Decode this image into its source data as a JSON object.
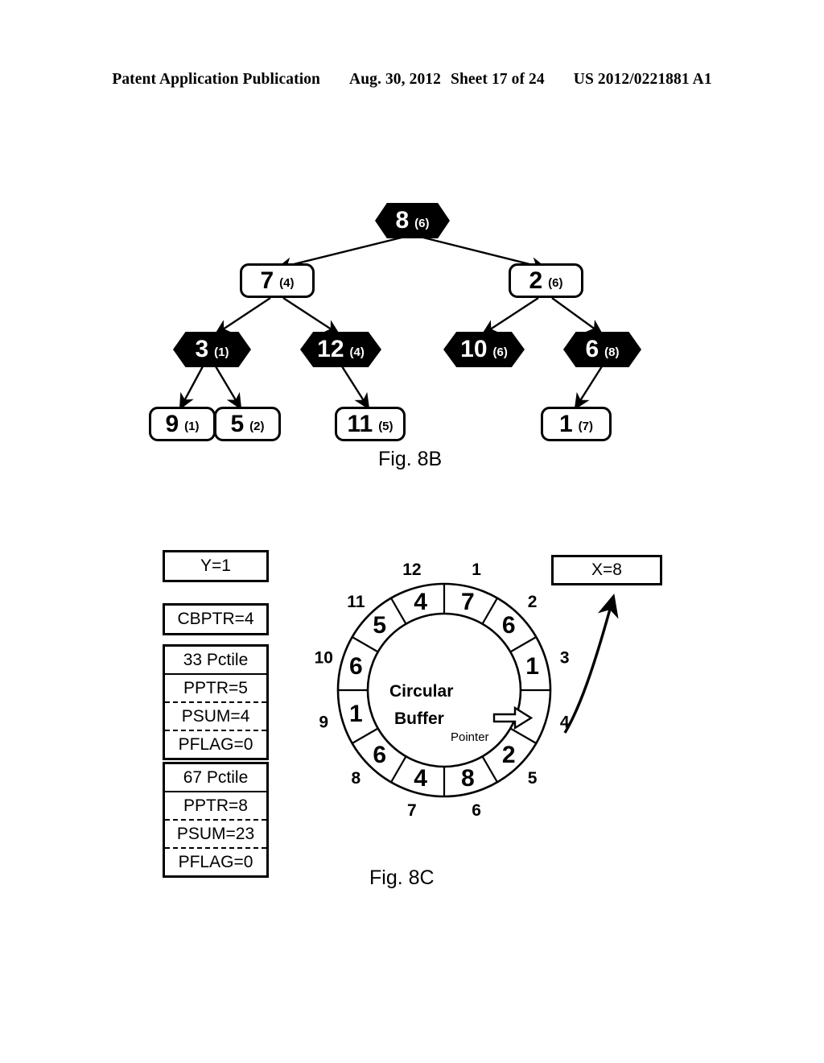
{
  "header": {
    "publication": "Patent Application Publication",
    "date": "Aug. 30, 2012",
    "sheet": "Sheet 17 of 24",
    "patent_number": "US 2012/0221881 A1"
  },
  "fig8b": {
    "caption": "Fig. 8B",
    "nodes": [
      {
        "id": "n8",
        "value": "8",
        "count": "(6)",
        "shape": "hexagon",
        "fill": "black"
      },
      {
        "id": "n7",
        "value": "7",
        "count": "(4)",
        "shape": "rectangle",
        "fill": "white"
      },
      {
        "id": "n2",
        "value": "2",
        "count": "(6)",
        "shape": "rectangle",
        "fill": "white"
      },
      {
        "id": "n3",
        "value": "3",
        "count": "(1)",
        "shape": "hexagon",
        "fill": "black"
      },
      {
        "id": "n12",
        "value": "12",
        "count": "(4)",
        "shape": "hexagon",
        "fill": "black"
      },
      {
        "id": "n10",
        "value": "10",
        "count": "(6)",
        "shape": "hexagon",
        "fill": "black"
      },
      {
        "id": "n6",
        "value": "6",
        "count": "(8)",
        "shape": "hexagon",
        "fill": "black"
      },
      {
        "id": "n9",
        "value": "9",
        "count": "(1)",
        "shape": "rectangle",
        "fill": "white"
      },
      {
        "id": "n5",
        "value": "5",
        "count": "(2)",
        "shape": "rectangle",
        "fill": "white"
      },
      {
        "id": "n11",
        "value": "11",
        "count": "(5)",
        "shape": "rectangle",
        "fill": "white"
      },
      {
        "id": "n1",
        "value": "1",
        "count": "(7)",
        "shape": "rectangle",
        "fill": "white"
      }
    ],
    "edges": [
      {
        "from": "n8",
        "to": "n7"
      },
      {
        "from": "n8",
        "to": "n2"
      },
      {
        "from": "n7",
        "to": "n3"
      },
      {
        "from": "n7",
        "to": "n12"
      },
      {
        "from": "n2",
        "to": "n10"
      },
      {
        "from": "n2",
        "to": "n6"
      },
      {
        "from": "n3",
        "to": "n9"
      },
      {
        "from": "n3",
        "to": "n5"
      },
      {
        "from": "n12",
        "to": "n11"
      },
      {
        "from": "n6",
        "to": "n1"
      }
    ]
  },
  "fig8c": {
    "caption": "Fig. 8C",
    "y_box": "Y=1",
    "cbptr_box": "CBPTR=4",
    "x_box": "X=8",
    "percentile_blocks": [
      {
        "title": "33 Pctile",
        "rows": [
          "PPTR=5",
          "PSUM=4",
          "PFLAG=0"
        ]
      },
      {
        "title": "67 Pctile",
        "rows": [
          "PPTR=8",
          "PSUM=23",
          "PFLAG=0"
        ]
      }
    ],
    "buffer": {
      "center_line1": "Circular",
      "center_line2": "Buffer",
      "pointer_label": "Pointer",
      "pointer_position": "4",
      "slots": [
        {
          "position": "1",
          "value": "7"
        },
        {
          "position": "2",
          "value": "6"
        },
        {
          "position": "3",
          "value": "1"
        },
        {
          "position": "4",
          "value": ""
        },
        {
          "position": "5",
          "value": "2"
        },
        {
          "position": "6",
          "value": "8"
        },
        {
          "position": "7",
          "value": "4"
        },
        {
          "position": "8",
          "value": "6"
        },
        {
          "position": "9",
          "value": "1"
        },
        {
          "position": "10",
          "value": "6"
        },
        {
          "position": "11",
          "value": "5"
        },
        {
          "position": "12",
          "value": "4"
        }
      ]
    }
  }
}
